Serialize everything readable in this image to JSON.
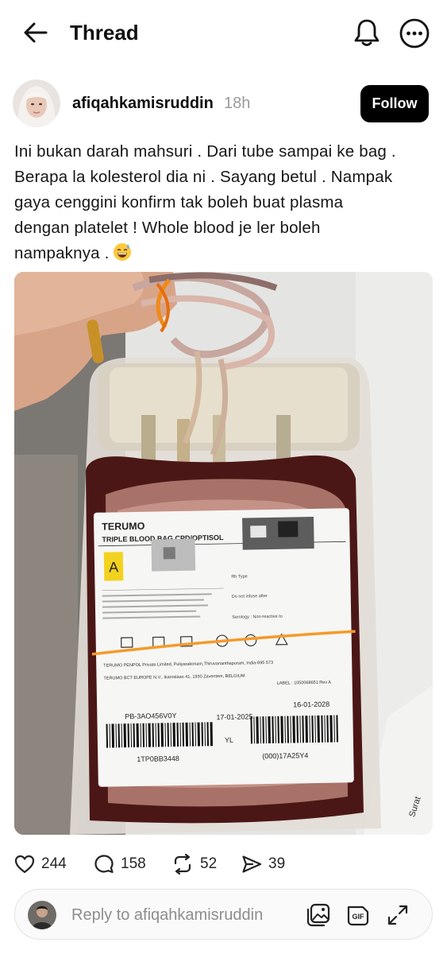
{
  "header": {
    "title": "Thread",
    "icons": [
      "back-arrow-icon",
      "bell-icon",
      "more-icon"
    ]
  },
  "post": {
    "username": "afiqahkamisruddin",
    "time": "18h",
    "follow_label": "Follow",
    "text_lines": [
      "Ini bukan darah mahsuri . Dari tube sampai ke bag .",
      "Berapa la kolesterol dia ni . Sayang betul . Nampak",
      "gaya cenggini konfirm tak boleh buat plasma",
      "dengan platelet ! Whole blood je ler boleh",
      "nampaknya ."
    ],
    "emoji": "grinning-sweat-face"
  },
  "photo": {
    "label_brand": "TERUMO",
    "label_title": "TRIPLE BLOOD BAG CPD/OPTISOL",
    "group": "A",
    "rh_type": "Rh Type",
    "do_not_before": "Do not infuse after",
    "serology": "Serology : Non-reactive to",
    "manufacturer": "TERUMO PENPOL Private Limited, Puliyarakonam,Thiruvananthapuram, India-695 573",
    "ec_rep": "TERUMO BCT EUROPE N.V., Ikaroslaan 41, 1930 Zaventem, BELGIUM",
    "ref": "PB-3AO456V0Y",
    "date1": "17-01-2025",
    "date2": "16-01-2028",
    "yl": "YL",
    "lot1": "1TP0BB3448",
    "lot2": "(000)17A25Y4",
    "label_code": "LABEL : 1050068651 Rev A",
    "side_text": "Surat"
  },
  "actions": {
    "likes": "244",
    "comments": "158",
    "reposts": "52",
    "shares": "39"
  },
  "reply": {
    "placeholder": "Reply to afiqahkamisruddin",
    "icons": [
      "image-icon",
      "gif-icon",
      "expand-icon"
    ]
  }
}
